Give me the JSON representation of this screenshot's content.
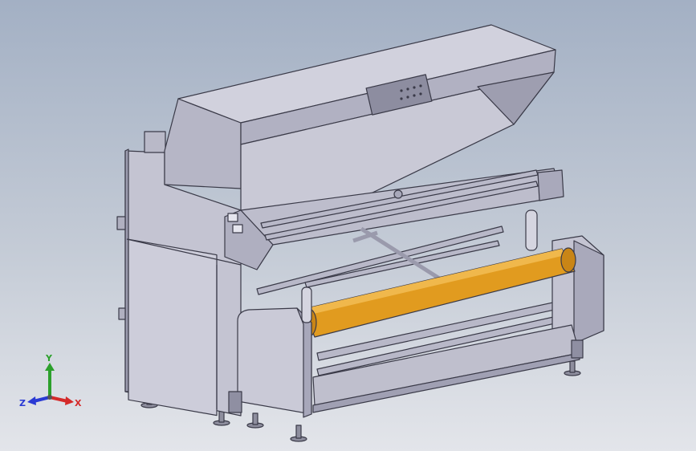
{
  "viewport": {
    "background_top": "#a3b0c4",
    "background_bottom": "#e3e5ea"
  },
  "model": {
    "body_color": "#c9c9d6",
    "shadow_color": "#9c9caf",
    "roller_color": "#e19b1f",
    "edge_color": "#3a3a48"
  },
  "triad": {
    "x_label": "X",
    "y_label": "Y",
    "z_label": "Z",
    "x_color": "#d42a2a",
    "y_color": "#2ca02c",
    "z_color": "#2a3ad4"
  }
}
